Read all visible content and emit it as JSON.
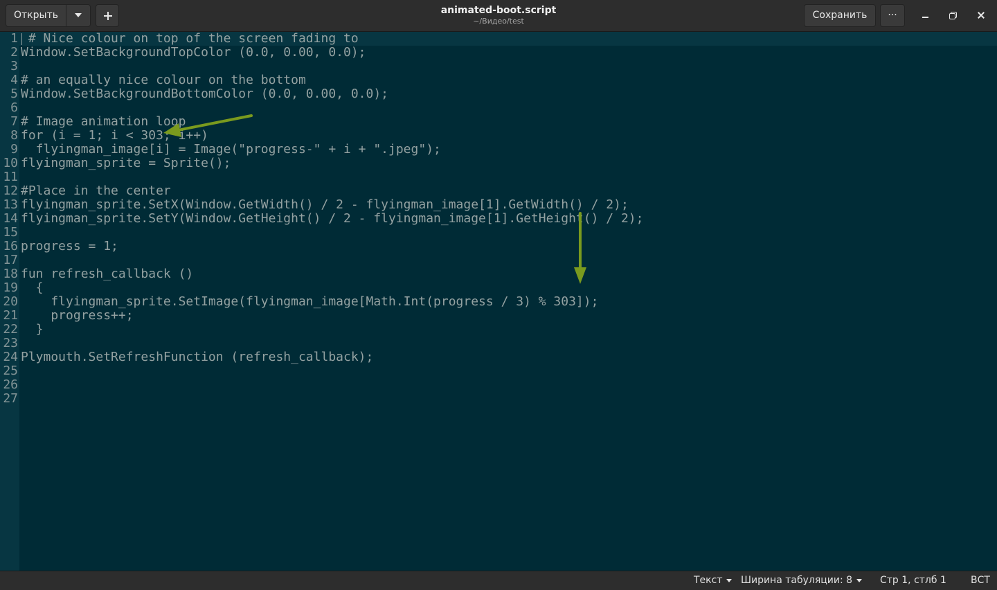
{
  "header": {
    "open_label": "Открыть",
    "save_label": "Сохранить",
    "menu_label": "···",
    "title": "animated-boot.script",
    "subtitle": "~/Видео/test"
  },
  "editor": {
    "lines": [
      {
        "n": "1",
        "text": " # Nice colour on top of the screen fading to"
      },
      {
        "n": "2",
        "text": "Window.SetBackgroundTopColor (0.0, 0.00, 0.0);"
      },
      {
        "n": "3",
        "text": ""
      },
      {
        "n": "4",
        "text": "# an equally nice colour on the bottom"
      },
      {
        "n": "5",
        "text": "Window.SetBackgroundBottomColor (0.0, 0.00, 0.0);"
      },
      {
        "n": "6",
        "text": ""
      },
      {
        "n": "7",
        "text": "# Image animation loop"
      },
      {
        "n": "8",
        "text": "for (i = 1; i < 303; i++)"
      },
      {
        "n": "9",
        "text": "  flyingman_image[i] = Image(\"progress-\" + i + \".jpeg\");"
      },
      {
        "n": "10",
        "text": "flyingman_sprite = Sprite();"
      },
      {
        "n": "11",
        "text": ""
      },
      {
        "n": "12",
        "text": "#Place in the center"
      },
      {
        "n": "13",
        "text": "flyingman_sprite.SetX(Window.GetWidth() / 2 - flyingman_image[1].GetWidth() / 2);"
      },
      {
        "n": "14",
        "text": "flyingman_sprite.SetY(Window.GetHeight() / 2 - flyingman_image[1].GetHeight() / 2);"
      },
      {
        "n": "15",
        "text": ""
      },
      {
        "n": "16",
        "text": "progress = 1;"
      },
      {
        "n": "17",
        "text": ""
      },
      {
        "n": "18",
        "text": "fun refresh_callback ()"
      },
      {
        "n": "19",
        "text": "  {"
      },
      {
        "n": "20",
        "text": "    flyingman_sprite.SetImage(flyingman_image[Math.Int(progress / 3) % 303]);"
      },
      {
        "n": "21",
        "text": "    progress++;"
      },
      {
        "n": "22",
        "text": "  }"
      },
      {
        "n": "23",
        "text": ""
      },
      {
        "n": "24",
        "text": "Plymouth.SetRefreshFunction (refresh_callback);"
      },
      {
        "n": "25",
        "text": ""
      },
      {
        "n": "26",
        "text": ""
      },
      {
        "n": "27",
        "text": ""
      }
    ]
  },
  "statusbar": {
    "language": "Текст",
    "tab_width": "Ширина табуляции: 8",
    "position": "Стр 1, стлб 1",
    "mode": "ВСТ"
  },
  "colors": {
    "background": "#002b36",
    "gutter": "#073642",
    "text": "#93a1a1",
    "annotation_arrow": "#7a9a1e"
  }
}
